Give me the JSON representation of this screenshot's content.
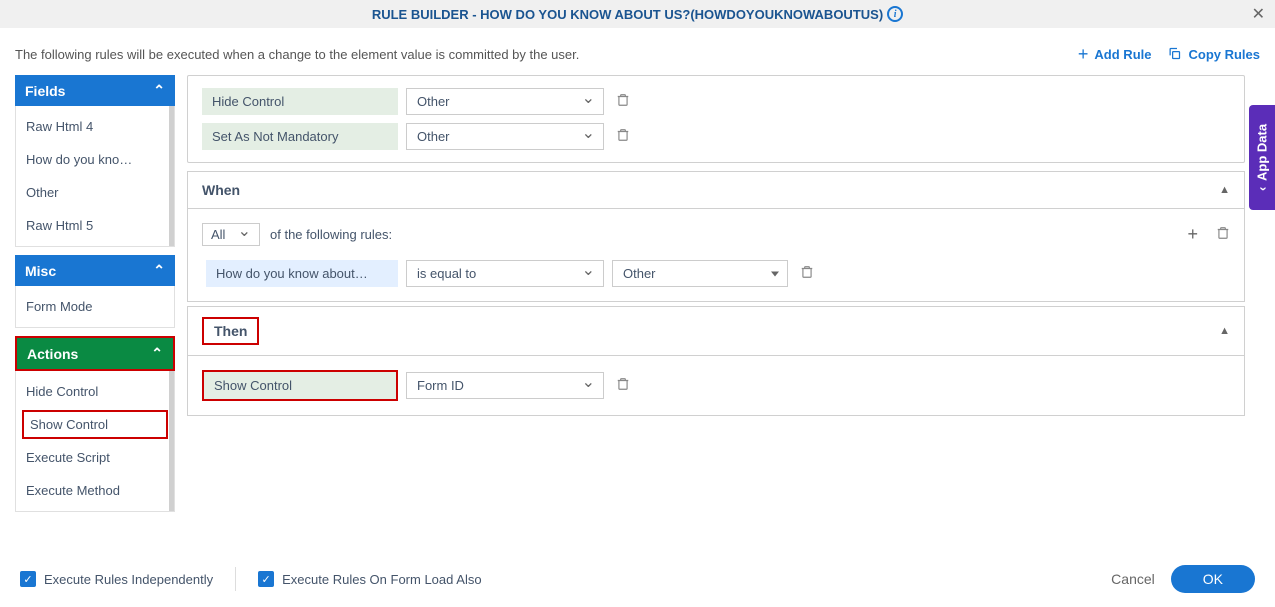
{
  "header": {
    "title": "RULE BUILDER - HOW DO YOU KNOW ABOUT US?(HOWDOYOUKNOWABOUTUS)"
  },
  "sub_header": {
    "text": "The following rules will be executed when a change to the element value is committed by the user.",
    "add_rule": "Add Rule",
    "copy_rules": "Copy Rules"
  },
  "sidebar": {
    "fields": {
      "label": "Fields",
      "items": [
        "Raw Html 4",
        "How do you kno…",
        "Other",
        "Raw Html 5"
      ]
    },
    "misc": {
      "label": "Misc",
      "items": [
        "Form Mode"
      ]
    },
    "actions": {
      "label": "Actions",
      "items": [
        "Hide Control",
        "Show Control",
        "Execute Script",
        "Execute Method"
      ]
    }
  },
  "rule1": {
    "row1_action": "Hide Control",
    "row1_target": "Other",
    "row2_action": "Set As Not Mandatory",
    "row2_target": "Other"
  },
  "when": {
    "title": "When",
    "quant": "All",
    "quant_suffix": "of the following rules:",
    "row_field": "How do you know about…",
    "row_op": "is equal to",
    "row_val": "Other"
  },
  "then": {
    "title": "Then",
    "row_action": "Show Control",
    "row_target": "Form ID"
  },
  "app_data": "App Data",
  "footer": {
    "cb1": "Execute Rules Independently",
    "cb2": "Execute Rules On Form Load Also",
    "cancel": "Cancel",
    "ok": "OK"
  }
}
